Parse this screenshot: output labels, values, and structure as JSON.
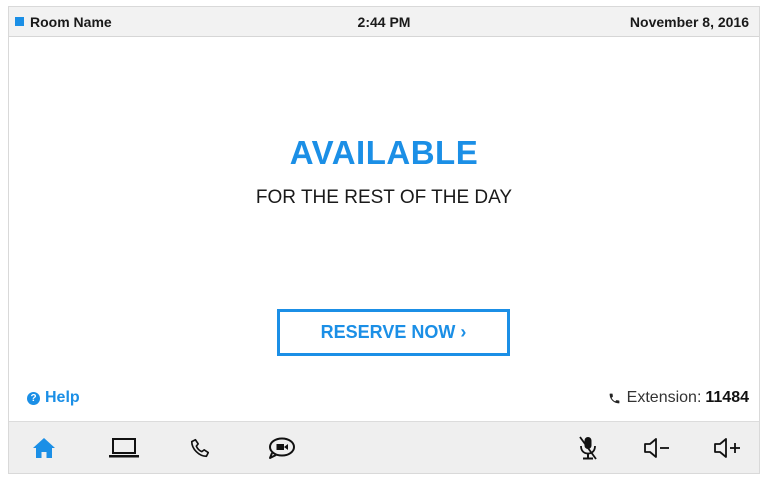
{
  "status_bar": {
    "room_name": "Room Name",
    "time": "2:44 PM",
    "date": "November 8, 2016"
  },
  "main": {
    "headline": "AVAILABLE",
    "subline": "FOR THE REST OF THE DAY",
    "reserve_button": "RESERVE NOW ›"
  },
  "footer": {
    "help_icon": "?",
    "help_label": "Help",
    "extension_label": "Extension:",
    "extension_number": "11484"
  },
  "toolbar": {
    "items": [
      "home-icon",
      "laptop-icon",
      "phone-icon",
      "video-chat-icon",
      "mic-muted-icon",
      "volume-down-icon",
      "volume-up-icon"
    ]
  },
  "colors": {
    "accent": "#1b8fe6",
    "toolbar_bg": "#efefef",
    "status_bg": "#f2f2f2"
  }
}
